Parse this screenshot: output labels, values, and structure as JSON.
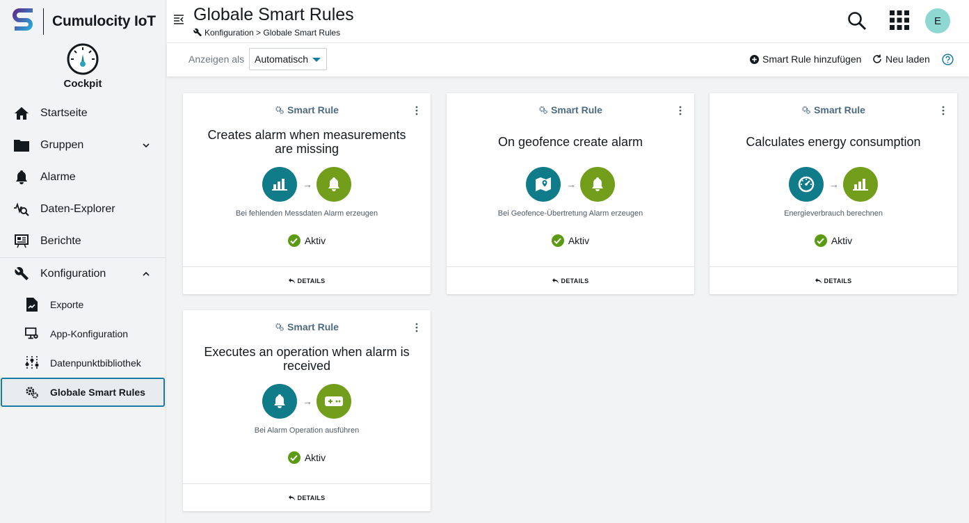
{
  "brand": {
    "name": "Cumulocity IoT"
  },
  "app": {
    "name": "Cockpit"
  },
  "sidebar": {
    "items": [
      {
        "label": "Startseite"
      },
      {
        "label": "Gruppen"
      },
      {
        "label": "Alarme"
      },
      {
        "label": "Daten-Explorer"
      },
      {
        "label": "Berichte"
      },
      {
        "label": "Konfiguration"
      }
    ],
    "sub": [
      {
        "label": "Exporte"
      },
      {
        "label": "App-Konfiguration"
      },
      {
        "label": "Datenpunktbibliothek"
      },
      {
        "label": "Globale Smart Rules"
      }
    ]
  },
  "header": {
    "title": "Globale Smart Rules",
    "breadcrumb": "Konfiguration > Globale Smart Rules",
    "avatar": "E"
  },
  "actionbar": {
    "view_label": "Anzeigen als",
    "view_value": "Automatisch",
    "add_label": "Smart Rule hinzufügen",
    "reload_label": "Neu laden"
  },
  "cards": [
    {
      "category": "Smart Rule",
      "title": "Creates alarm when measurements are missing",
      "description": "Bei fehlenden Messdaten Alarm erzeugen",
      "status": "Aktiv",
      "details": "DETAILS",
      "icons": [
        "bar-chart-icon",
        "bell-icon"
      ]
    },
    {
      "category": "Smart Rule",
      "title": "On geofence create alarm",
      "description": "Bei Geofence-Übertretung Alarm erzeugen",
      "status": "Aktiv",
      "details": "DETAILS",
      "icons": [
        "map-pin-icon",
        "bell-icon"
      ]
    },
    {
      "category": "Smart Rule",
      "title": "Calculates energy consumption",
      "description": "Energieverbrauch berechnen",
      "status": "Aktiv",
      "details": "DETAILS",
      "icons": [
        "speedometer-icon",
        "bar-chart-icon"
      ]
    },
    {
      "category": "Smart Rule",
      "title": "Executes an operation when alarm is received",
      "description": "Bei Alarm Operation ausführen",
      "status": "Aktiv",
      "details": "DETAILS",
      "icons": [
        "bell-icon",
        "gamepad-icon"
      ]
    }
  ],
  "colors": {
    "teal": "#107b89",
    "green": "#729e1b",
    "accent": "#1a7ba0"
  }
}
